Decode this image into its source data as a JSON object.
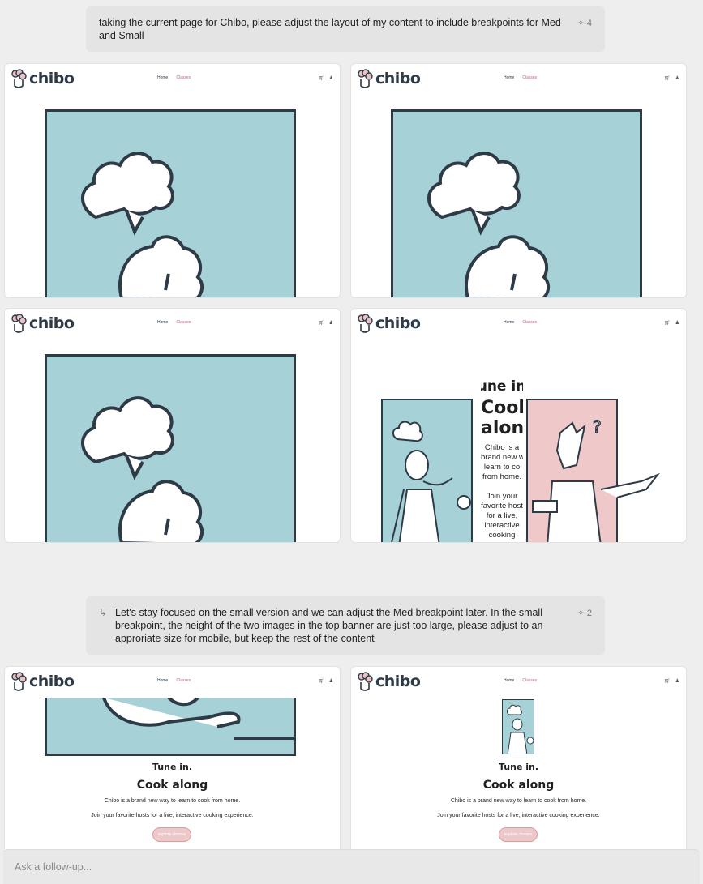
{
  "messages": [
    {
      "text": "taking the current page for Chibo, please adjust the layout of my content to include breakpoints for Med and Small",
      "count": "4"
    },
    {
      "text": "Let's stay focused on the small version and we can adjust the Med breakpoint later. In the small breakpoint, the height of the two images in the top banner are just too large, please adjust to an approriate size for mobile, but keep the rest of the content",
      "count": "2"
    }
  ],
  "site": {
    "logo": "chibo",
    "nav_home": "Home",
    "nav_classes": "Classes",
    "hero_line1": "Tune in.",
    "hero_line2": "Cook along",
    "hero_body1": "Chibo is a brand new way to learn to cook from home.",
    "hero_body2": "Join your favorite hosts for a live, interactive cooking experience.",
    "cta": "explore classes",
    "med_line1": "Tune in",
    "med_line2": "Cook",
    "med_line3": "along",
    "med_body": [
      "Chibo is a",
      "brand new w",
      "learn to co",
      "from home.",
      "Join your",
      "favorite host",
      "for a live,",
      "interactive",
      "cooking"
    ]
  },
  "composer": {
    "placeholder": "Ask a follow-up..."
  },
  "colors": {
    "teal": "#a6d1d6",
    "pink": "#efc9c9",
    "ink": "#2e3a45"
  }
}
